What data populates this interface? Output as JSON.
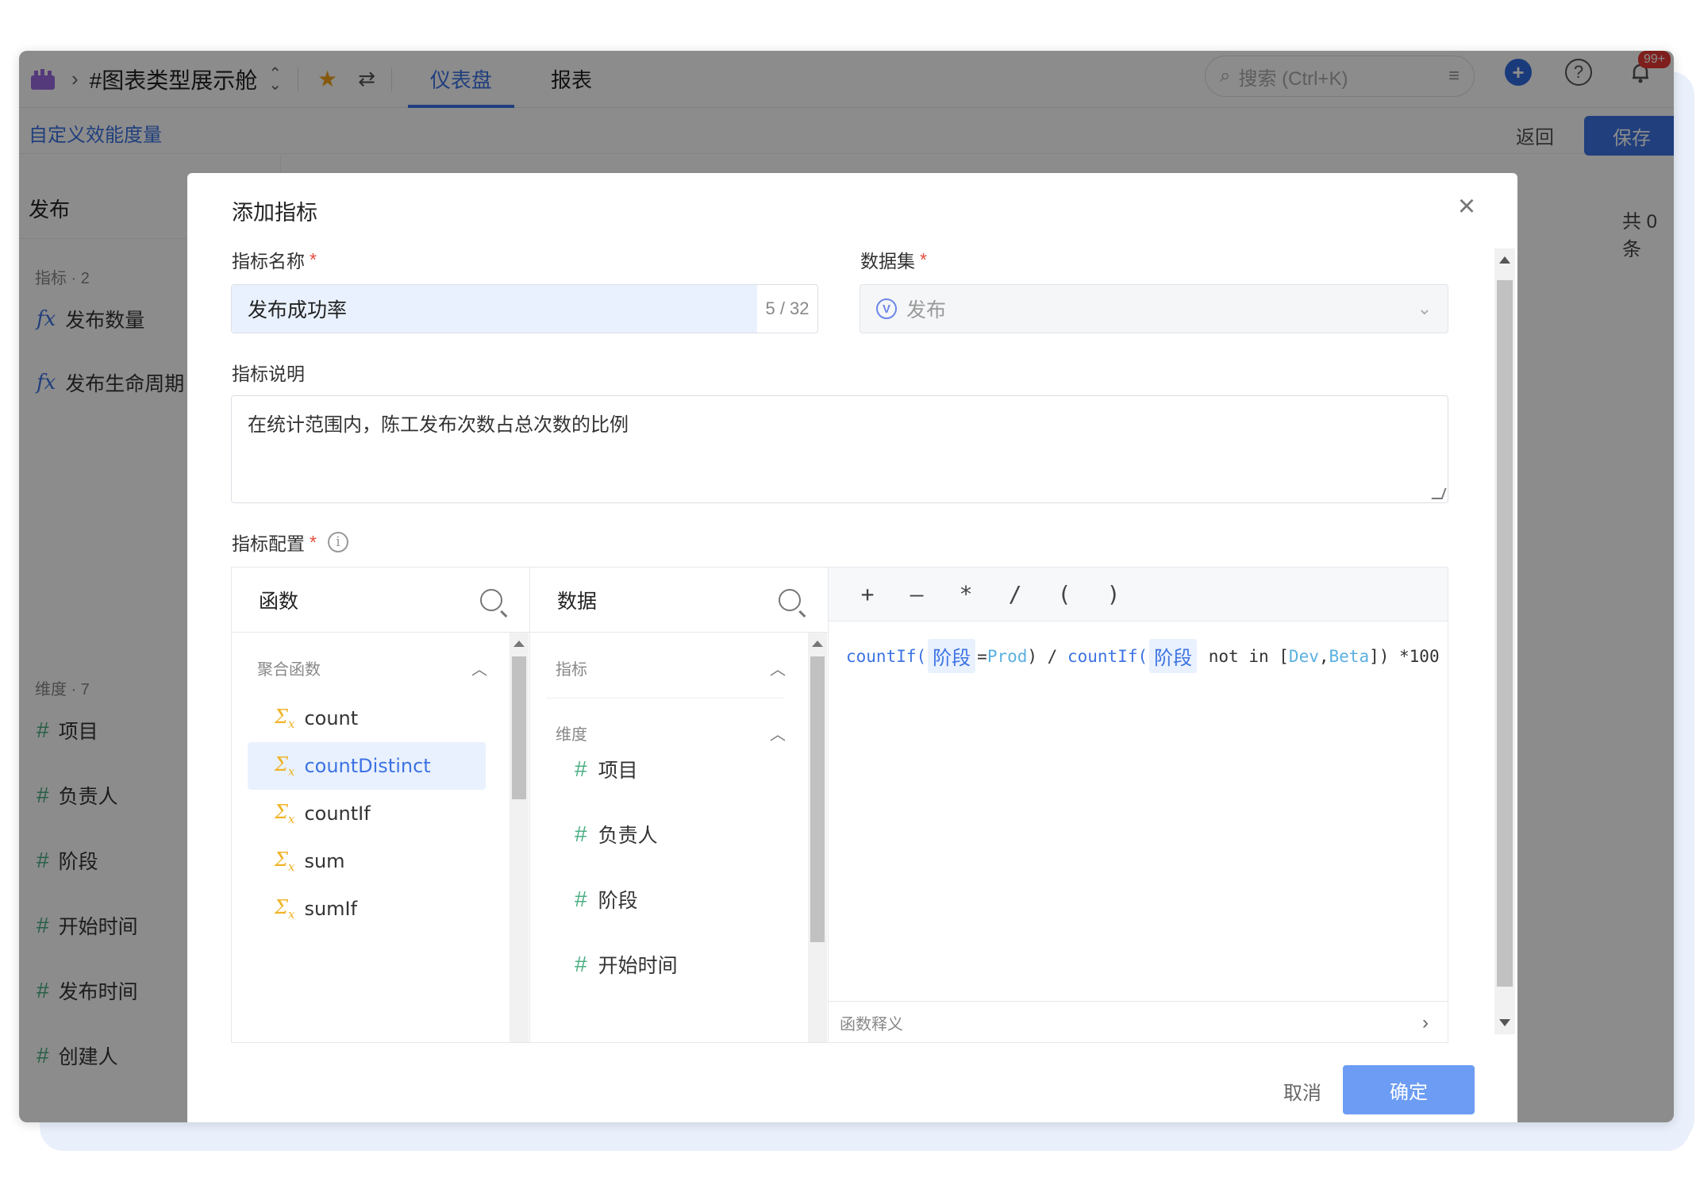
{
  "topbar": {
    "project_title": "#图表类型展示舱",
    "tabs": [
      {
        "label": "仪表盘",
        "active": true
      },
      {
        "label": "报表",
        "active": false
      }
    ],
    "search_placeholder": "搜索 (Ctrl+K)",
    "notification_badge": "99+"
  },
  "subbar": {
    "breadcrumb": "自定义效能度量",
    "back_label": "返回",
    "save_label": "保存"
  },
  "left_panel": {
    "title": "发布",
    "metrics_section": "指标 · 2",
    "metrics": [
      "发布数量",
      "发布生命周期"
    ],
    "dimensions_section": "维度 · 7",
    "dimensions": [
      "项目",
      "负责人",
      "阶段",
      "开始时间",
      "发布时间",
      "创建人"
    ]
  },
  "right_count": "共 0 条",
  "modal": {
    "title": "添加指标",
    "name_label": "指标名称",
    "name_value": "发布成功率",
    "name_counter": "5 / 32",
    "dataset_label": "数据集",
    "dataset_value": "发布",
    "desc_label": "指标说明",
    "desc_value": "在统计范围内，陈工发布次数占总次数的比例",
    "config_label": "指标配置",
    "functions_column": {
      "title": "函数",
      "group": "聚合函数",
      "items": [
        "count",
        "countDistinct",
        "countIf",
        "sum",
        "sumIf"
      ],
      "selected": "countDistinct"
    },
    "data_column": {
      "title": "数据",
      "group_metrics": "指标",
      "group_dimensions": "维度",
      "items": [
        "项目",
        "负责人",
        "阶段",
        "开始时间"
      ]
    },
    "operators": [
      "+",
      "—",
      "*",
      "/",
      "(",
      ")"
    ],
    "formula": {
      "fn1": "countIf(",
      "tag1": "阶段",
      "eq": "=",
      "val1": "Prod",
      "close1": ") / ",
      "fn2": "countIf(",
      "tag2": "阶段",
      "not_in": " not in [",
      "val2": "Dev",
      "comma": ",",
      "val3": "Beta",
      "tail": "]) *100"
    },
    "fn_def_label": "函数释义",
    "cancel_label": "取消",
    "ok_label": "确定"
  },
  "colors": {
    "accent": "#3d73e3",
    "ok_button": "#6c9cf3",
    "selected_bg": "#e9f1fe",
    "dimension_hash": "#4caf83",
    "function_sigma": "#f0b429"
  }
}
